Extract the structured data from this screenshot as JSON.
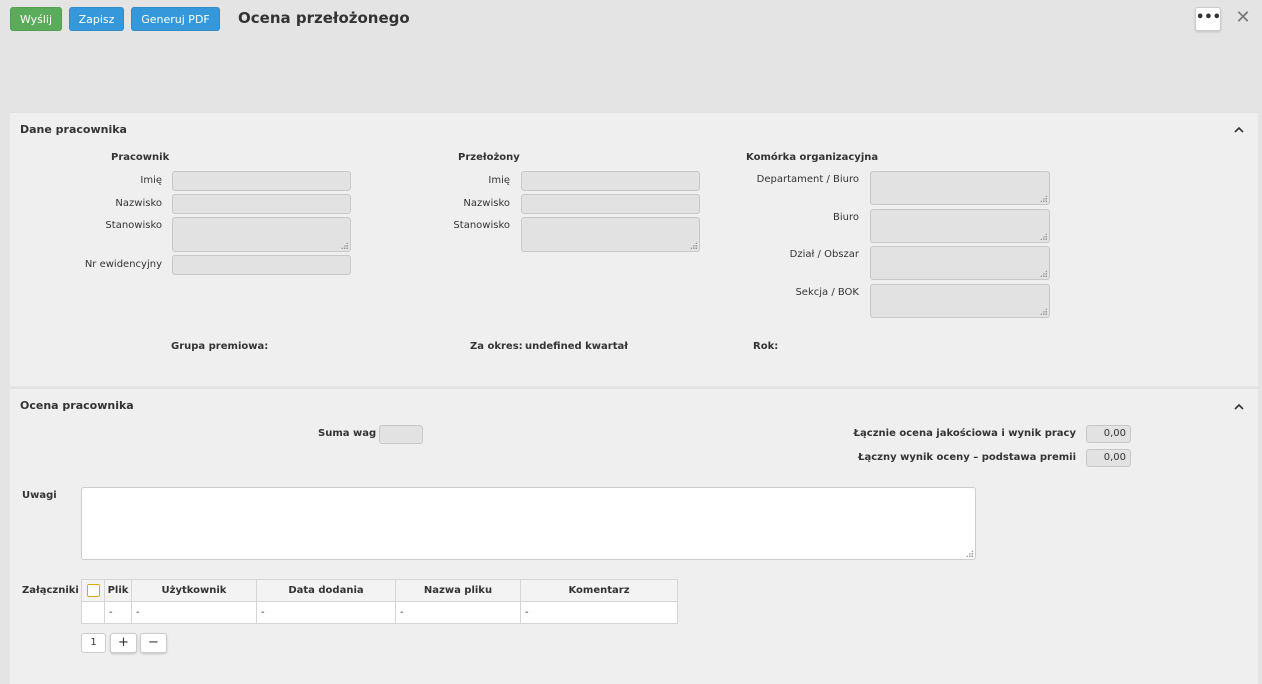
{
  "toolbar": {
    "send_label": "Wyślij",
    "save_label": "Zapisz",
    "pdf_label": "Generuj PDF",
    "title": "Ocena przełożonego",
    "more_label": "•••",
    "close_label": "✕",
    "colors": {
      "send": "#5aac5a",
      "save": "#3498db",
      "pdf": "#3498db"
    }
  },
  "employee_section": {
    "title": "Dane pracownika",
    "employee": {
      "header": "Pracownik",
      "first_name_label": "Imię",
      "last_name_label": "Nazwisko",
      "position_label": "Stanowisko",
      "record_no_label": "Nr ewidencyjny"
    },
    "supervisor": {
      "header": "Przełożony",
      "first_name_label": "Imię",
      "last_name_label": "Nazwisko",
      "position_label": "Stanowisko"
    },
    "org_unit": {
      "header": "Komórka organizacyjna",
      "department_label": "Departament / Biuro",
      "office_label": "Biuro",
      "division_label": "Dział / Obszar",
      "section_label": "Sekcja / BOK"
    },
    "bonus_group_label": "Grupa premiowa:",
    "period_label": "Za okres:",
    "period_value": "undefined kwartał",
    "year_label": "Rok:"
  },
  "evaluation_section": {
    "title": "Ocena pracownika",
    "weights_sum_label": "Suma wag",
    "total_quality_label": "Łącznie ocena jakościowa i wynik pracy",
    "total_quality_value": "0,00",
    "total_result_label": "Łączny wynik oceny – podstawa premii",
    "total_result_value": "0,00",
    "notes_label": "Uwagi",
    "attachments_label": "Załączniki",
    "attachments_table": {
      "columns": [
        "Plik",
        "Użytkownik",
        "Data dodania",
        "Nazwa pliku",
        "Komentarz"
      ],
      "row": [
        "-",
        "-",
        "-",
        "-",
        "-"
      ]
    },
    "pagination": {
      "page": "1",
      "add": "+",
      "remove": "−"
    }
  }
}
